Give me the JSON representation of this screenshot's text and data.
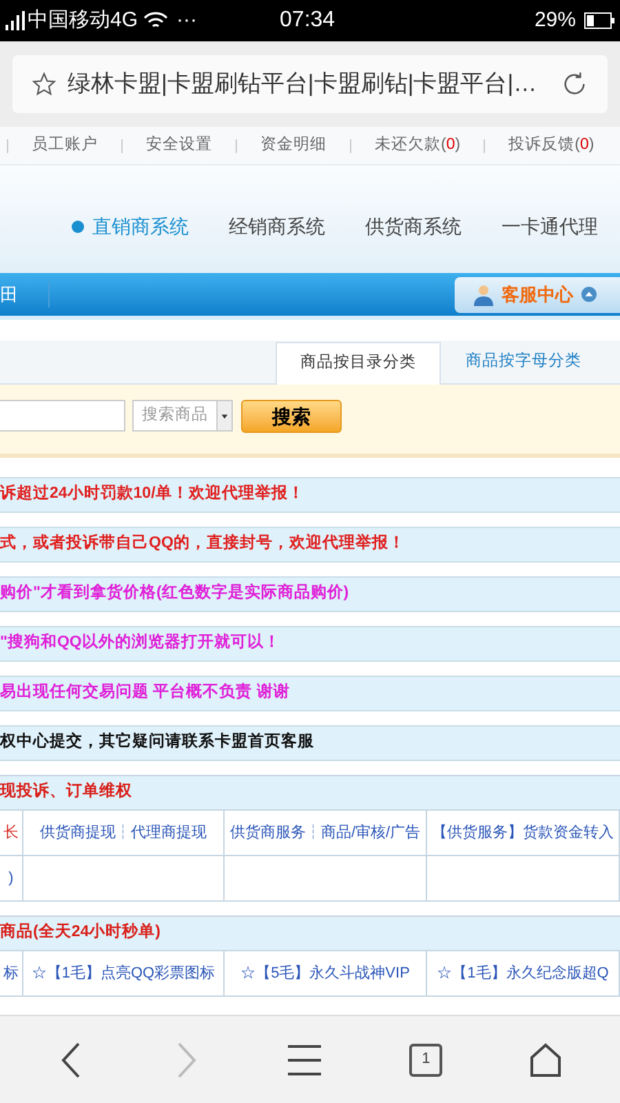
{
  "status_bar": {
    "carrier": "中国移动4G",
    "dots": "···",
    "time": "07:34",
    "battery": "29%"
  },
  "address_bar": {
    "title": "绿林卡盟|卡盟刷钻平台|卡盟刷钻|卡盟平台|…"
  },
  "top_links": [
    {
      "label": "员工账户"
    },
    {
      "label": "安全设置"
    },
    {
      "label": "资金明细"
    },
    {
      "label": "未还欠款",
      "open": "(",
      "count": "0",
      "close": ")"
    },
    {
      "label": "投诉反馈",
      "open": "(",
      "count": "0",
      "close": ")"
    }
  ],
  "systems": [
    {
      "label": "直销商系统",
      "selected": true
    },
    {
      "label": "经销商系统",
      "selected": false
    },
    {
      "label": "供货商系统",
      "selected": false
    },
    {
      "label": "一卡通代理",
      "selected": false
    }
  ],
  "menu_bar": {
    "cut_label": "田",
    "service": "客服中心"
  },
  "category_tabs": [
    {
      "label": "商品按目录分类",
      "selected": true
    },
    {
      "label": "商品按字母分类",
      "selected": false
    }
  ],
  "search": {
    "select": "搜索商品",
    "button": "搜索"
  },
  "notices": [
    {
      "text": "诉超过24小时罚款10/单！欢迎代理举报！",
      "color": "#e0201f"
    },
    {
      "text": "式，或者投诉带自己QQ的，直接封号，欢迎代理举报！",
      "color": "#e0201f"
    },
    {
      "text": "购价\"才看到拿货价格(红色数字是实际商品购价)",
      "color": "#e020d8"
    },
    {
      "text": "\"搜狗和QQ以外的浏览器打开就可以！",
      "color": "#e020d8"
    },
    {
      "text": "易出现任何交易问题 平台概不负责 谢谢",
      "color": "#e020d8"
    },
    {
      "text": "权中心提交，其它疑问请联系卡盟首页客服",
      "color": "#111111"
    }
  ],
  "sections": [
    {
      "title": "现投诉、订单维权",
      "rows": [
        {
          "cells": [
            {
              "text": "长",
              "color": "#d9302a"
            },
            {
              "text": "供货商提现┆代理商提现",
              "color": "#2a55b8"
            },
            {
              "text": "供货商服务┆商品/审核/广告",
              "color": "#2a55b8"
            },
            {
              "text": "【供货服务】货款资金转入",
              "color": "#2a55b8"
            }
          ]
        },
        {
          "cells": [
            {
              "text": ")",
              "color": "#2a55b8"
            }
          ]
        }
      ]
    },
    {
      "title": "商品(全天24小时秒单)",
      "rows": [
        {
          "cells": [
            {
              "text": "标",
              "color": "#2a55b8"
            },
            {
              "text": "☆【1毛】点亮QQ彩票图标",
              "color": "#2a55b8"
            },
            {
              "text": "☆【5毛】永久斗战神VIP",
              "color": "#2a55b8"
            },
            {
              "text": "☆【1毛】永久纪念版超Q",
              "color": "#2a55b8"
            }
          ]
        }
      ]
    }
  ],
  "bottom_nav": {
    "tab_count": "1",
    "forward_enabled": false
  }
}
